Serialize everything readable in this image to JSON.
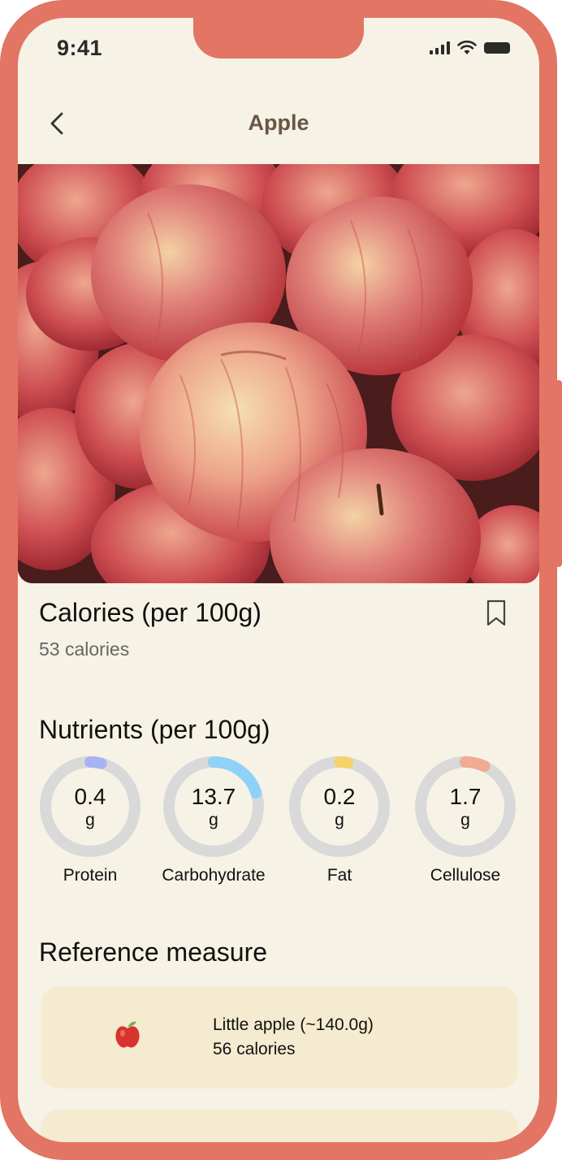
{
  "status": {
    "time": "9:41"
  },
  "nav": {
    "title": "Apple"
  },
  "calories": {
    "title": "Calories (per 100g)",
    "value": "53 calories"
  },
  "nutrients": {
    "title": "Nutrients (per 100g)",
    "items": [
      {
        "value": "0.4",
        "unit": "g",
        "label": "Protein",
        "color": "#A9B2F5",
        "fraction": 0.04
      },
      {
        "value": "13.7",
        "unit": "g",
        "label": "Carbohydrate",
        "color": "#8FD2F8",
        "fraction": 0.2
      },
      {
        "value": "0.2",
        "unit": "g",
        "label": "Fat",
        "color": "#F5D36A",
        "fraction": 0.03
      },
      {
        "value": "1.7",
        "unit": "g",
        "label": "Cellulose",
        "color": "#F2AA90",
        "fraction": 0.07
      }
    ]
  },
  "reference": {
    "title": "Reference measure",
    "items": [
      {
        "name": "Little apple (~140.0g)",
        "calories": "56 calories"
      }
    ]
  },
  "colors": {
    "frame": "#E27563",
    "background": "#F7F2E6",
    "card": "#F5EBD0",
    "ring_track": "#D9D9D9"
  }
}
